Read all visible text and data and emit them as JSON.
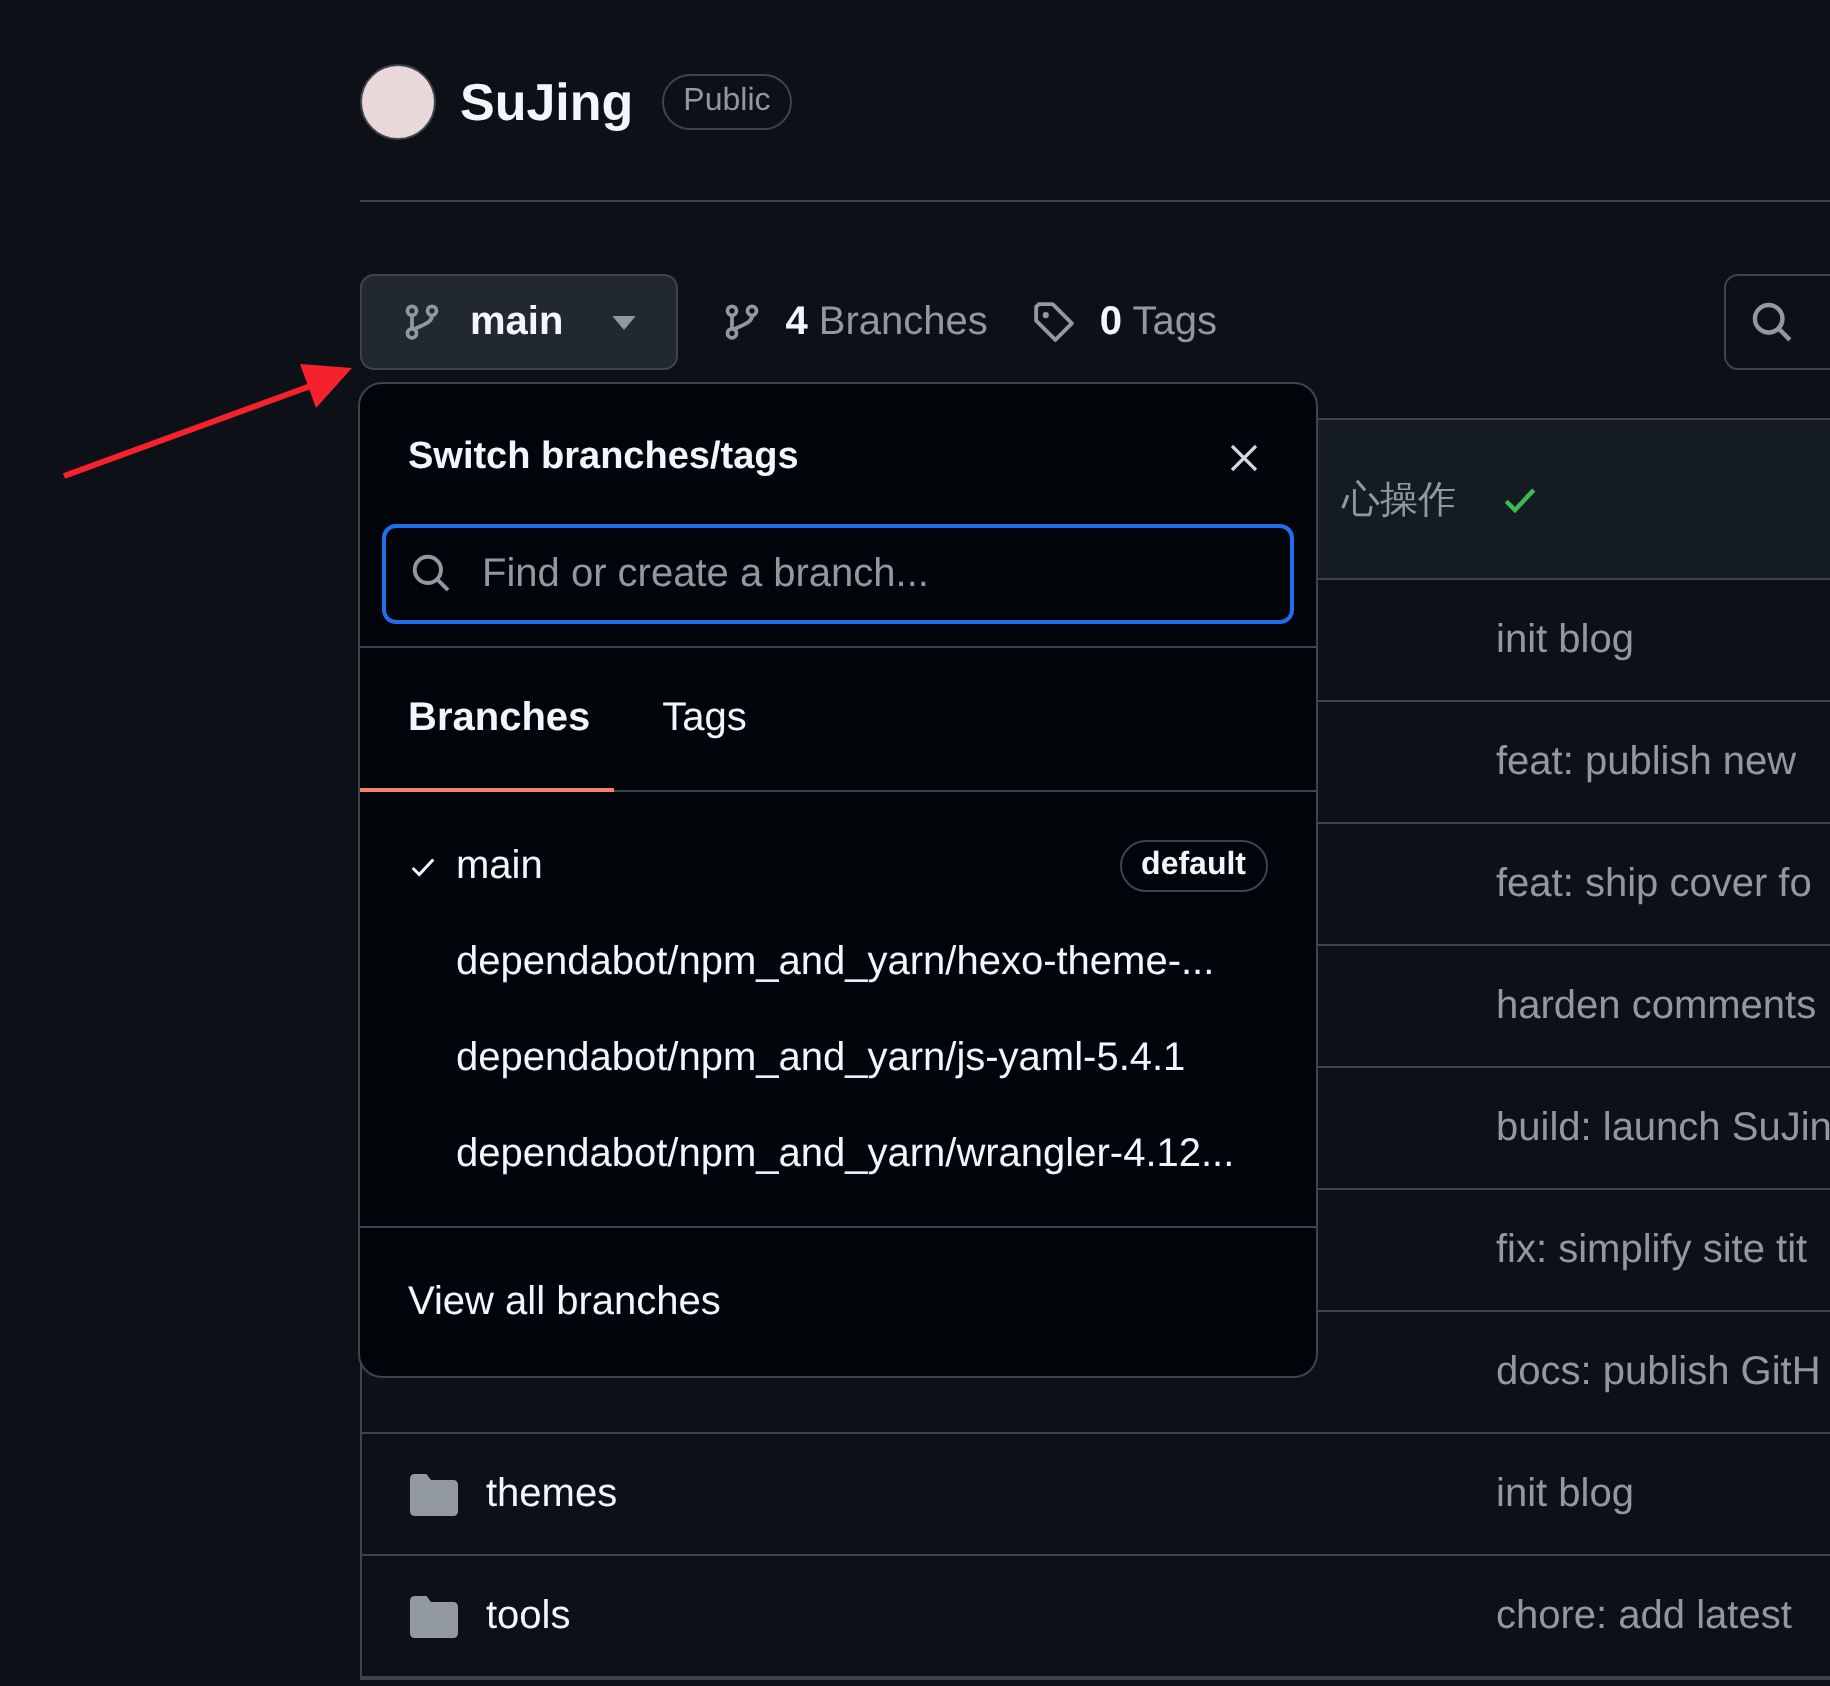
{
  "repo": {
    "name": "SuJing",
    "visibility": "Public"
  },
  "branch_bar": {
    "current_branch": "main",
    "branches_link": "**4** Branches",
    "tags_link": "**0** Tags"
  },
  "latest_commit": {
    "message": "心操作",
    "checks_passed": true
  },
  "files": [
    {
      "message": "init blog"
    },
    {
      "message": "feat: publish new"
    },
    {
      "message": "feat: ship cover fo"
    },
    {
      "message": "harden comments"
    },
    {
      "message": "build: launch SuJin"
    },
    {
      "message": "fix: simplify site tit"
    },
    {
      "message": "docs: publish GitH"
    },
    {
      "kind": "folder",
      "name": "themes",
      "message": "init blog"
    },
    {
      "kind": "folder",
      "name": "tools",
      "message": "chore: add latest"
    }
  ],
  "branch_menu": {
    "title": "Switch branches/tags",
    "search": {
      "placeholder": "Find or create a branch..."
    },
    "tabs": [
      {
        "label": "Branches",
        "selected": true
      },
      {
        "label": "Tags",
        "selected": false
      }
    ],
    "branches": [
      {
        "name": "main",
        "selected": true,
        "badge": "default"
      },
      {
        "name": "dependabot/npm_and_yarn/hexo-theme-...",
        "selected": false
      },
      {
        "name": "dependabot/npm_and_yarn/js-yaml-5.4.1",
        "selected": false
      },
      {
        "name": "dependabot/npm_and_yarn/wrangler-4.12...",
        "selected": false
      }
    ],
    "footer_link": "View all branches"
  }
}
